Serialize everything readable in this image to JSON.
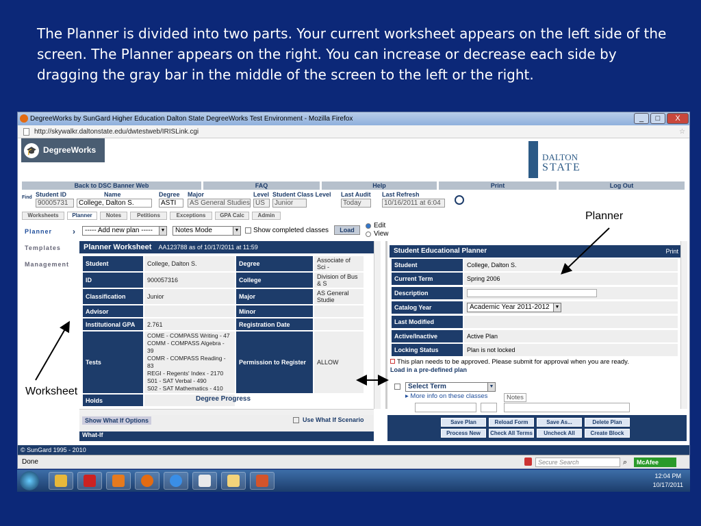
{
  "caption": "The Planner is divided into two parts.  Your current worksheet appears on the left side of the screen. The Planner appears on the right. You can increase or decrease each side by dragging the gray bar in the middle of the screen to the left or the right.",
  "window": {
    "title": "DegreeWorks by SunGard Higher Education Dalton State DegreeWorks Test Environment - Mozilla Firefox",
    "url": "http://skywalkr.daltonstate.edu/dwtestweb/IRISLink.cgi",
    "minimize": "_",
    "maximize": "□",
    "close": "X"
  },
  "logo": {
    "text": "DegreeWorks",
    "dalton1": "DALTON",
    "dalton2": "STATE"
  },
  "nav": [
    "Back to DSC Banner Web",
    "FAQ",
    "Help",
    "Print",
    "Log Out"
  ],
  "student_bar": {
    "find_label": "Find",
    "student_id_label": "Student ID",
    "student_id": "90005731",
    "name_label": "Name",
    "name": "College, Dalton S.",
    "degree_label": "Degree",
    "degree": "ASTI",
    "major_label": "Major",
    "major": "AS General Studies",
    "level_label": "Level",
    "level": "US",
    "class_label": "Student Class Level",
    "class": "Junior",
    "audit_label": "Last Audit",
    "audit": "Today",
    "refresh_label": "Last Refresh",
    "refresh": "10/16/2011 at 6:04"
  },
  "tabs": [
    "Worksheets",
    "Planner",
    "Notes",
    "Petitions",
    "Exceptions",
    "GPA Calc",
    "Admin"
  ],
  "sidebar": [
    "Planner",
    "Templates",
    "Management"
  ],
  "controls": {
    "add_plan": "----- Add new plan -----",
    "mode": "Notes Mode",
    "show_completed": "Show completed classes",
    "load": "Load",
    "edit": "Edit",
    "view": "View"
  },
  "worksheet": {
    "title": "Planner Worksheet",
    "sub": "AA123788 as of 10/17/2011 at 11:59",
    "rows": [
      {
        "k1": "Student",
        "v1": "College, Dalton S.",
        "k2": "Degree",
        "v2": "Associate of Sci -"
      },
      {
        "k1": "ID",
        "v1": "900057316",
        "k2": "College",
        "v2": "Division of Bus & S"
      },
      {
        "k1": "Classification",
        "v1": "Junior",
        "k2": "Major",
        "v2": "AS General Studie"
      },
      {
        "k1": "Advisor",
        "v1": "",
        "k2": "Minor",
        "v2": ""
      },
      {
        "k1": "Institutional GPA",
        "v1": "2.761",
        "k2": "Registration Date",
        "v2": ""
      }
    ],
    "tests_label": "Tests",
    "tests": [
      "COME - COMPASS Writing - 47",
      "COMM - COMPASS Algebra - 39",
      "COMR - COMPASS Reading - 83",
      "REGI - Regents' Index - 2170",
      "S01 - SAT Verbal - 490",
      "S02 - SAT Mathematics - 410"
    ],
    "permission_label": "Permission to Register",
    "permission": "ALLOW",
    "holds_label": "Holds",
    "degree_progress": "Degree Progress"
  },
  "planner": {
    "title": "Student Educational Planner",
    "print": "Print",
    "rows": [
      {
        "k": "Student",
        "v": "College, Dalton S."
      },
      {
        "k": "Current Term",
        "v": "Spring 2006"
      },
      {
        "k": "Description",
        "v": ""
      },
      {
        "k": "Catalog Year",
        "v": "Academic Year 2011-2012"
      },
      {
        "k": "Last Modified",
        "v": ""
      },
      {
        "k": "Active/Inactive",
        "v": "Active Plan"
      },
      {
        "k": "Locking Status",
        "v": "Plan is not locked"
      }
    ],
    "approval": "This plan needs to be approved. Please submit for approval when you are ready.",
    "predefined": "Load in a pre-defined plan",
    "select_term": "Select Term",
    "more_info": "More info on these classes",
    "notes": "Notes"
  },
  "bottom": {
    "whatif_options": "Show What If Options",
    "use_whatif": "Use What If Scenario",
    "whatif": "What-If"
  },
  "buttons": [
    "Save Plan",
    "Reload Form",
    "Save As...",
    "Delete Plan",
    "Process New",
    "Check All Terms",
    "Uncheck All",
    "Create Block"
  ],
  "copyright": "© SunGard 1995 - 2010",
  "status": {
    "done": "Done",
    "secure_search": "Secure Search",
    "mcafee": "McAfee"
  },
  "clock": {
    "time": "12:04 PM",
    "date": "10/17/2011"
  },
  "annotations": {
    "planner": "Planner",
    "worksheet": "Worksheet"
  }
}
